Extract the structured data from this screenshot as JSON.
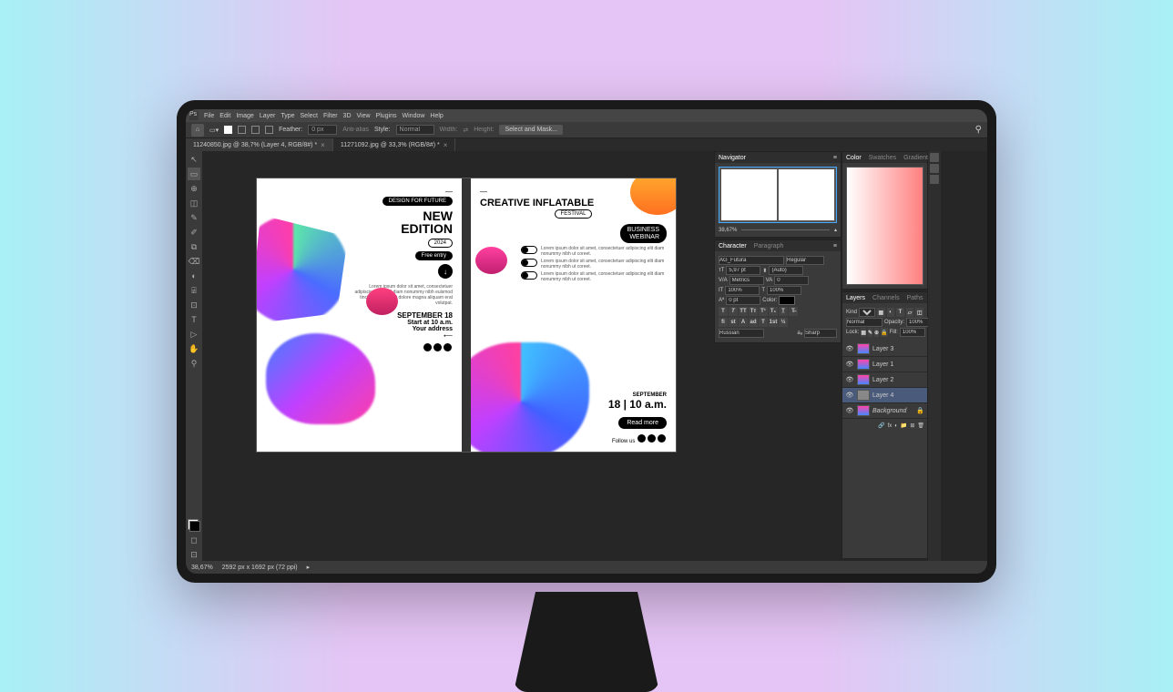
{
  "menu": [
    "File",
    "Edit",
    "Image",
    "Layer",
    "Type",
    "Select",
    "Filter",
    "3D",
    "View",
    "Plugins",
    "Window",
    "Help"
  ],
  "options": {
    "feather": "Feather:",
    "feather_val": "0 px",
    "antialias": "Anti-alias",
    "style": "Style:",
    "style_val": "Normal",
    "width": "Width:",
    "height": "Height:",
    "selectmask": "Select and Mask..."
  },
  "tabs": [
    {
      "label": "11240850.jpg @ 38,7% (Layer 4, RGB/8#) *",
      "active": true
    },
    {
      "label": "11271092.jpg @ 33,3% (RGB/8#) *",
      "active": false
    }
  ],
  "tools": [
    "↖",
    "▭",
    "⊕",
    "◫",
    "✎",
    "✐",
    "⧉",
    "⌫",
    "◐",
    "⍯",
    "⊡",
    "T",
    "▷",
    "✋",
    "⚲"
  ],
  "poster1": {
    "badge": "DESIGN FOR FUTURE",
    "h1": "NEW",
    "h2": "EDITION",
    "year": "2024",
    "entry": "Free entry",
    "lorem": "Lorem ipsum dolor sit amet, consectetuer adipiscing elit, sed diam nonummy nibh euismod tincidunt ut laoreet dolore magna aliquam erat volutpat.",
    "date": "SEPTEMBER 18",
    "start": "Start at 10 a.m.",
    "addr": "Your address"
  },
  "poster2": {
    "title": "CREATIVE INFLATABLE",
    "sub": "FESTIVAL",
    "b1": "BUSINESS",
    "b2": "WEBINAR",
    "lorem": "Lorem ipsum dolor sit amet, consectetuer adipiscing elit diam nonummy nibh ut coreet.",
    "month": "SEPTEMBER",
    "day": "18",
    "time": "10 a.m.",
    "read": "Read more",
    "follow": "Follow us"
  },
  "navigator": {
    "title": "Navigator",
    "zoom": "38,67%"
  },
  "character": {
    "t1": "Character",
    "t2": "Paragraph",
    "font": "AG_Futura",
    "weight": "Regular",
    "size": "5,97 pt",
    "leading": "(Auto)",
    "kerning": "Metrics",
    "tracking": "0",
    "vscale": "100%",
    "hscale": "100%",
    "baseline": "0 pt",
    "color": "Color:",
    "lang": "Russian",
    "aa": "Sharp"
  },
  "color": {
    "t1": "Color",
    "t2": "Swatches",
    "t3": "Gradients"
  },
  "layers": {
    "t1": "Layers",
    "t2": "Channels",
    "t3": "Paths",
    "kind": "Kind",
    "mode": "Normal",
    "opacity": "Opacity:",
    "opval": "100%",
    "lock": "Lock:",
    "fill": "Fill:",
    "fillval": "100%",
    "items": [
      {
        "name": "Layer 3",
        "vis": true
      },
      {
        "name": "Layer 1",
        "vis": true
      },
      {
        "name": "Layer 2",
        "vis": true
      },
      {
        "name": "Layer 4",
        "vis": true,
        "sel": true
      },
      {
        "name": "Background",
        "vis": true,
        "locked": true
      }
    ]
  },
  "status": {
    "zoom": "38,67%",
    "dims": "2592 px x 1692 px (72 ppi)"
  }
}
